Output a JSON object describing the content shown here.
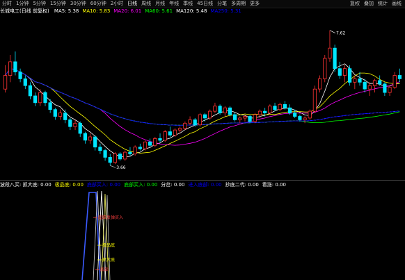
{
  "toolbar": {
    "items": [
      "分时",
      "1分钟",
      "5分钟",
      "15分钟",
      "30分钟",
      "60分钟",
      "2小时",
      "日线",
      "周线",
      "月线",
      "年线",
      "季线",
      "45日线",
      "分笔",
      "多周期",
      "更多"
    ],
    "active_index": 7,
    "right": [
      "复权",
      "叠加",
      "统计",
      "画线"
    ]
  },
  "info": {
    "title": "长城电工(日线 前复权)",
    "ma": [
      {
        "label": "MA5: 5.38",
        "color": "#ffffff"
      },
      {
        "label": "MA10: 5.83",
        "color": "#ffff00"
      },
      {
        "label": "MA20: 6.01",
        "color": "#ff00ff"
      },
      {
        "label": "MA60: 5.61",
        "color": "#00ff00"
      },
      {
        "label": "MA120: 5.48",
        "color": "#ffffff"
      },
      {
        "label": "MA250: 5.31",
        "color": "#0000ff"
      }
    ]
  },
  "price": {
    "high_label": "7.62",
    "low_label": "3.66",
    "ymin": 3.4,
    "ymax": 8.0,
    "candles": [
      [
        5.9,
        6.6,
        5.8,
        6.3
      ],
      [
        6.3,
        6.9,
        6.1,
        6.7
      ],
      [
        6.7,
        7.0,
        6.3,
        6.4
      ],
      [
        6.4,
        6.5,
        6.1,
        6.2
      ],
      [
        6.2,
        6.3,
        5.9,
        6.0
      ],
      [
        6.0,
        6.1,
        5.6,
        5.7
      ],
      [
        5.7,
        5.8,
        5.4,
        5.5
      ],
      [
        5.5,
        5.9,
        5.4,
        5.8
      ],
      [
        5.8,
        5.85,
        5.4,
        5.5
      ],
      [
        5.5,
        5.6,
        5.2,
        5.3
      ],
      [
        5.3,
        5.35,
        5.0,
        5.1
      ],
      [
        5.1,
        5.3,
        5.0,
        5.2
      ],
      [
        5.2,
        5.3,
        4.9,
        5.0
      ],
      [
        5.0,
        5.05,
        4.7,
        4.8
      ],
      [
        4.8,
        5.0,
        4.7,
        4.9
      ],
      [
        4.9,
        4.95,
        4.5,
        4.6
      ],
      [
        4.6,
        4.65,
        4.3,
        4.4
      ],
      [
        4.4,
        4.6,
        4.3,
        4.5
      ],
      [
        4.5,
        4.55,
        4.1,
        4.2
      ],
      [
        4.2,
        4.3,
        4.0,
        4.1
      ],
      [
        4.1,
        4.15,
        3.8,
        3.9
      ],
      [
        3.9,
        4.0,
        3.66,
        3.75
      ],
      [
        3.75,
        4.05,
        3.7,
        4.0
      ],
      [
        4.0,
        4.05,
        3.8,
        3.85
      ],
      [
        3.85,
        4.1,
        3.8,
        4.05
      ],
      [
        4.05,
        4.2,
        3.95,
        4.0
      ],
      [
        4.0,
        4.25,
        3.95,
        4.2
      ],
      [
        4.2,
        4.3,
        4.1,
        4.15
      ],
      [
        4.15,
        4.4,
        4.1,
        4.35
      ],
      [
        4.35,
        4.45,
        4.2,
        4.25
      ],
      [
        4.25,
        4.5,
        4.2,
        4.45
      ],
      [
        4.45,
        4.6,
        4.35,
        4.4
      ],
      [
        4.4,
        4.7,
        4.35,
        4.65
      ],
      [
        4.65,
        4.8,
        4.5,
        4.55
      ],
      [
        4.55,
        4.75,
        4.5,
        4.7
      ],
      [
        4.7,
        4.8,
        4.6,
        4.75
      ],
      [
        4.75,
        4.95,
        4.7,
        4.9
      ],
      [
        4.9,
        5.1,
        4.85,
        5.0
      ],
      [
        5.0,
        5.05,
        4.8,
        4.85
      ],
      [
        4.85,
        5.2,
        4.8,
        5.15
      ],
      [
        5.15,
        5.2,
        4.95,
        5.05
      ],
      [
        5.05,
        5.3,
        5.0,
        5.25
      ],
      [
        5.25,
        5.5,
        5.2,
        5.4
      ],
      [
        5.4,
        5.45,
        5.15,
        5.2
      ],
      [
        5.2,
        5.4,
        5.1,
        5.35
      ],
      [
        5.35,
        5.4,
        5.1,
        5.15
      ],
      [
        5.15,
        5.2,
        4.95,
        5.0
      ],
      [
        5.0,
        5.1,
        4.9,
        5.05
      ],
      [
        5.05,
        5.15,
        4.95,
        5.1
      ],
      [
        5.1,
        5.15,
        4.9,
        4.95
      ],
      [
        4.95,
        5.2,
        4.9,
        5.15
      ],
      [
        5.15,
        5.3,
        5.05,
        5.25
      ],
      [
        5.25,
        5.35,
        5.1,
        5.2
      ],
      [
        5.2,
        5.45,
        5.15,
        5.4
      ],
      [
        5.4,
        5.5,
        5.25,
        5.3
      ],
      [
        5.3,
        5.5,
        5.25,
        5.45
      ],
      [
        5.45,
        5.55,
        5.3,
        5.35
      ],
      [
        5.35,
        5.45,
        5.15,
        5.2
      ],
      [
        5.2,
        5.3,
        5.05,
        5.1
      ],
      [
        5.1,
        5.15,
        4.95,
        5.0
      ],
      [
        5.0,
        5.1,
        4.9,
        5.05
      ],
      [
        5.05,
        5.3,
        5.0,
        5.25
      ],
      [
        5.25,
        6.0,
        5.2,
        5.9
      ],
      [
        5.9,
        6.3,
        5.8,
        6.2
      ],
      [
        6.2,
        6.9,
        6.1,
        6.8
      ],
      [
        6.8,
        7.62,
        6.7,
        7.1
      ],
      [
        7.1,
        7.2,
        6.4,
        6.5
      ],
      [
        6.5,
        6.7,
        6.2,
        6.3
      ],
      [
        6.3,
        6.6,
        6.1,
        6.5
      ],
      [
        6.5,
        6.6,
        6.0,
        6.1
      ],
      [
        6.1,
        6.3,
        5.9,
        6.2
      ],
      [
        6.2,
        6.4,
        6.0,
        6.1
      ],
      [
        6.1,
        6.2,
        5.8,
        5.9
      ],
      [
        5.9,
        6.1,
        5.7,
        6.0
      ],
      [
        6.0,
        6.2,
        5.8,
        6.15
      ],
      [
        6.15,
        6.3,
        6.0,
        6.05
      ],
      [
        6.05,
        6.1,
        5.7,
        5.8
      ],
      [
        5.8,
        6.0,
        5.7,
        5.95
      ],
      [
        5.95,
        6.4,
        5.9,
        6.3
      ],
      [
        6.3,
        6.5,
        6.1,
        6.2
      ]
    ],
    "ma_colors": {
      "ma5": "#ffffff",
      "ma10": "#ffff00",
      "ma20": "#ff00ff",
      "ma60": "#00ff00",
      "ma120": "#ffffff",
      "ma250": "#0000ff"
    }
  },
  "indicator": {
    "labels": [
      {
        "text": "波段八买: 抓大底: 0.00",
        "color": "#ffffff"
      },
      {
        "text": "极品底: 0.00",
        "color": "#ffff00"
      },
      {
        "text": "底部买入: 0.00",
        "color": "#0000ff"
      },
      {
        "text": "底部买入: 0.00",
        "color": "#00ff00"
      },
      {
        "text": "分岔: 0.00",
        "color": "#ffffff"
      },
      {
        "text": "进入底部: 0.00",
        "color": "#0000ff"
      },
      {
        "text": "抄底二代: 0.00",
        "color": "#ffffff"
      },
      {
        "text": "看涨: 0.00",
        "color": "#ffffff"
      }
    ],
    "markers": [
      {
        "text": "超跌反弹买入",
        "color": "#ff4040"
      },
      {
        "text": "极品底",
        "color": "#ffff00"
      },
      {
        "text": "抓大底",
        "color": "#ffff00"
      },
      {
        "text": "底部",
        "color": "#ff4040"
      }
    ]
  }
}
